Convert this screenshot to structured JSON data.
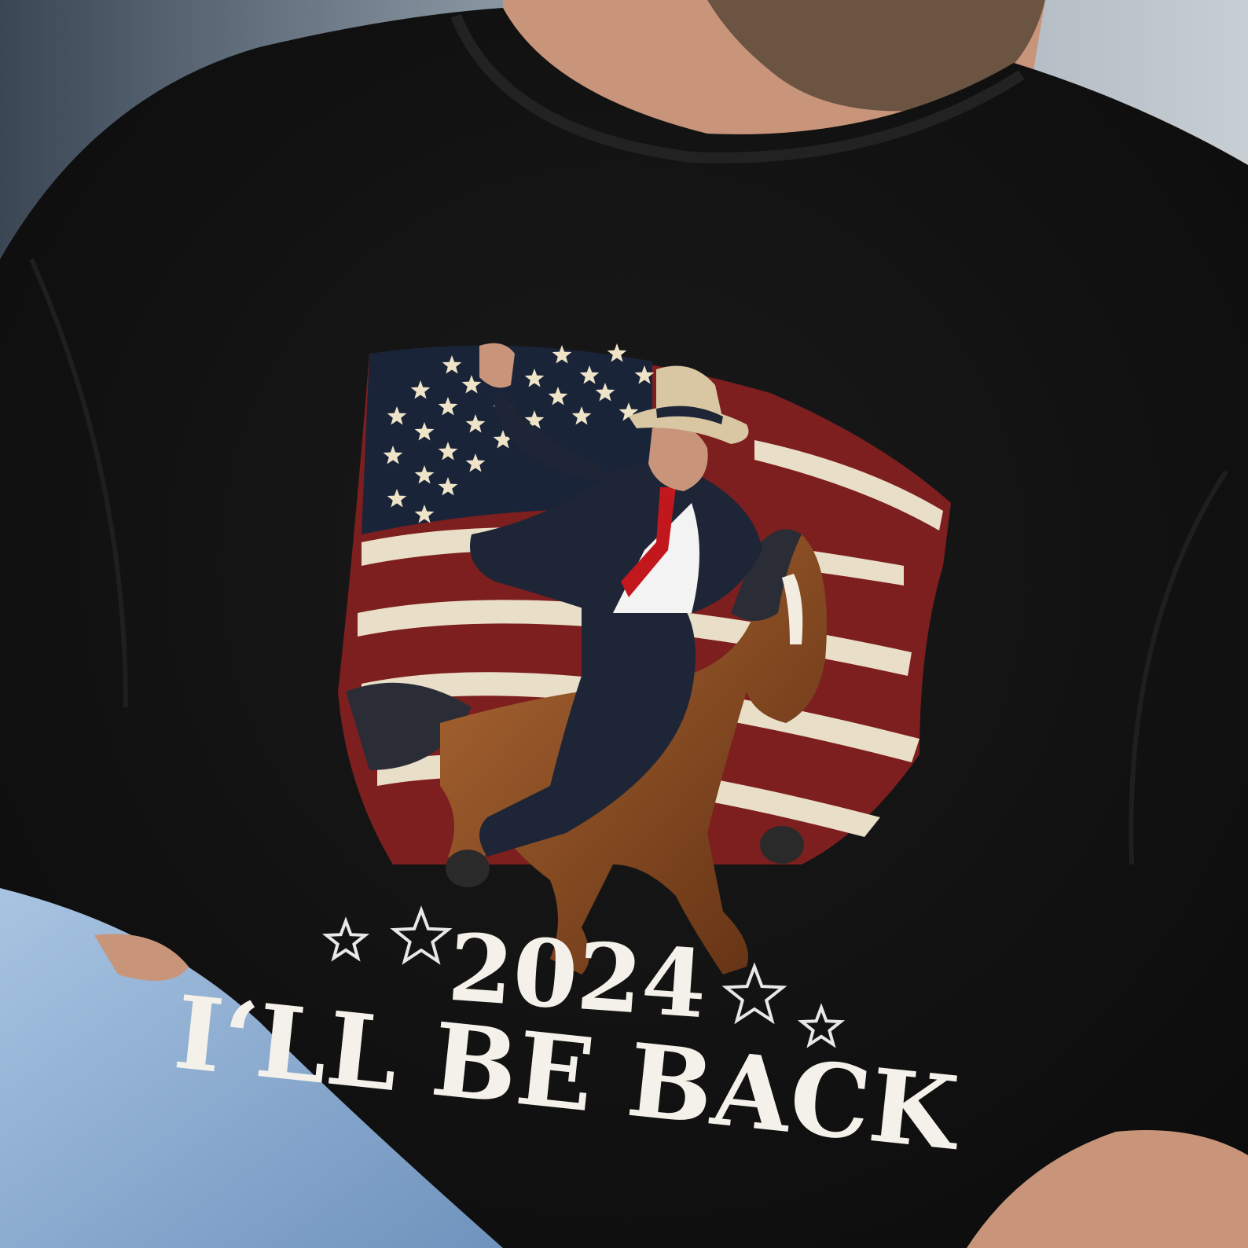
{
  "shirt": {
    "year_text": "2024",
    "slogan_text": "I‘LL BE BACK"
  },
  "colors": {
    "sweatshirt": "#131313",
    "flag_red": "#7d1f1f",
    "flag_cream": "#e9dfc8",
    "flag_navy": "#1a2438",
    "denim": "#8fb1d6",
    "skin": "#c9957a",
    "horse": "#8a4b22"
  },
  "icons": {
    "star": "star-icon"
  }
}
